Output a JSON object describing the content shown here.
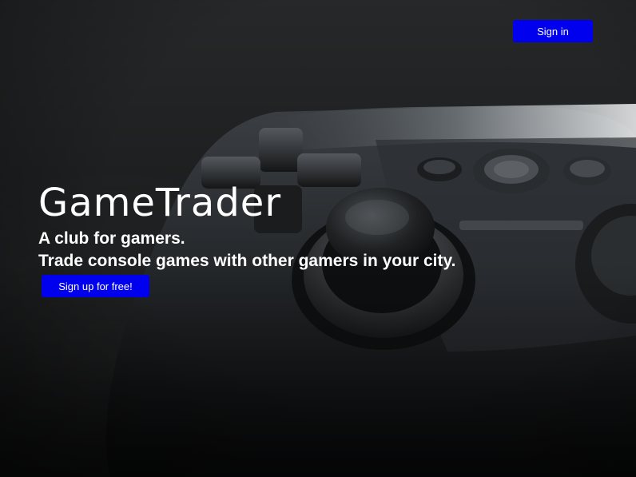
{
  "header": {
    "sign_in_label": "Sign in"
  },
  "hero": {
    "brand": "GameTrader",
    "tagline_line1": "A club for gamers.",
    "tagline_line2": "Trade console games with other gamers in your city.",
    "cta_label": "Sign up for free!",
    "background_image": "game-controller-photo"
  },
  "colors": {
    "button_bg": "#0000ee",
    "button_text": "#ffffff",
    "text": "#ffffff",
    "background": "#1b1c1d"
  }
}
